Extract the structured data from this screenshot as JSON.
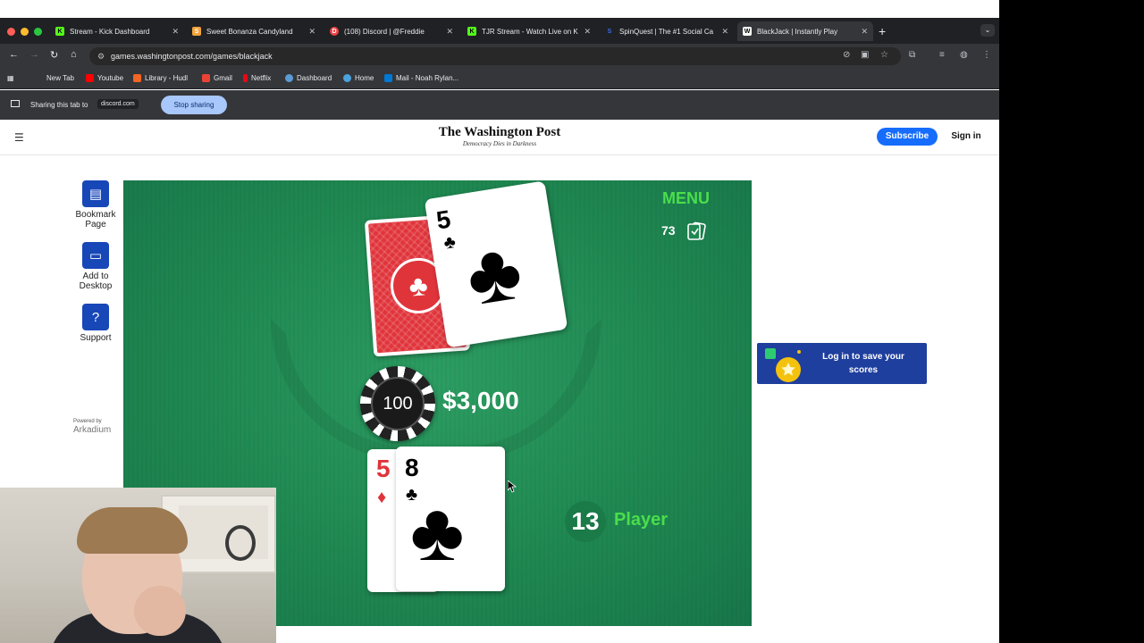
{
  "browser": {
    "tabs": [
      {
        "label": "Stream - Kick Dashboard",
        "icon": "kick-icon",
        "color": "#53fc18"
      },
      {
        "label": "Sweet Bonanza Candyland",
        "icon": "stake-icon",
        "color": "#f3a33a"
      },
      {
        "label": "(108) Discord | @Freddie",
        "icon": "discord-icon",
        "color": "#ed4245"
      },
      {
        "label": "TJR Stream - Watch Live on K",
        "icon": "kick-icon",
        "color": "#53fc18"
      },
      {
        "label": "SpinQuest | The #1 Social Ca",
        "icon": "spinquest-icon",
        "color": "#3a6df0"
      },
      {
        "label": "BlackJack | Instantly Play",
        "icon": "washingtonpost-icon",
        "color": "#ffffff"
      }
    ],
    "url": "games.washingtonpost.com/games/blackjack",
    "bookmarks": [
      {
        "label": "New Tab",
        "color": ""
      },
      {
        "label": "Youtube",
        "color": "#ff0000"
      },
      {
        "label": "Library - Hudl",
        "color": "#f26522"
      },
      {
        "label": "Gmail",
        "color": "#ea4335"
      },
      {
        "label": "Netflix",
        "color": "#e50914"
      },
      {
        "label": "Dashboard",
        "color": "#5b9bd5"
      },
      {
        "label": "Home",
        "color": "#4aa3df"
      },
      {
        "label": "Mail - Noah Rylan...",
        "color": "#0078d4"
      }
    ],
    "share_bar": {
      "text": "Sharing this tab to",
      "domain": "discord.com",
      "stop_label": "Stop sharing"
    }
  },
  "header": {
    "logo": "The Washington Post",
    "tagline": "Democracy Dies in Darkness",
    "subscribe_label": "Subscribe",
    "signin_label": "Sign in"
  },
  "sidebar": {
    "items": [
      {
        "label": "Bookmark Page",
        "icon": "bookmark-page-icon"
      },
      {
        "label": "Add to Desktop",
        "icon": "desktop-icon"
      },
      {
        "label": "Support",
        "icon": "help-icon"
      }
    ],
    "powered_by": "Powered by",
    "powered_brand": "Arkadium"
  },
  "game": {
    "menu_label": "MENU",
    "deck_count": "73",
    "dealer_cards": [
      {
        "rank": "5",
        "suit": "♣",
        "color": "#000000"
      }
    ],
    "bet_chip": "100",
    "bet_amount": "$3,000",
    "player_cards": [
      {
        "rank": "5",
        "suit": "♦",
        "color": "#e0343b"
      },
      {
        "rank": "8",
        "suit": "♣",
        "color": "#000000"
      }
    ],
    "player_score": "13",
    "player_label": "Player"
  },
  "login_banner": {
    "text": "Log in to save your scores"
  },
  "colors": {
    "table_green": "#1f8851",
    "accent_green": "#4ade4c",
    "subscribe_blue": "#166dfc"
  }
}
